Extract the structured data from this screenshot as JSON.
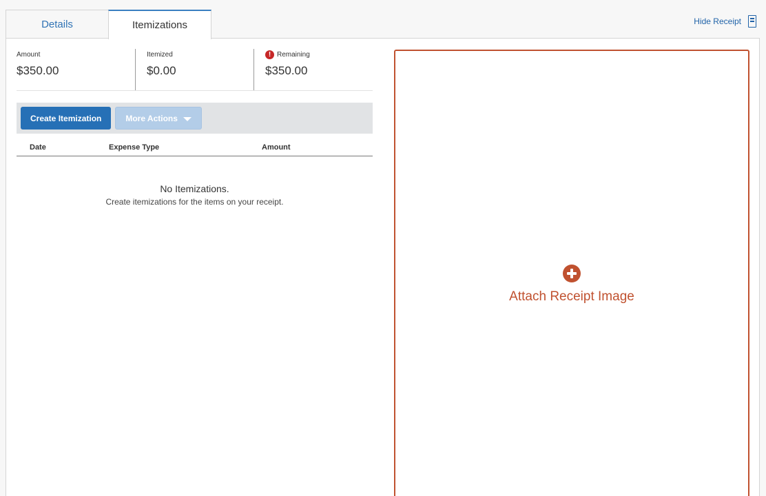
{
  "tabs": [
    {
      "label": "Details",
      "active": false
    },
    {
      "label": "Itemizations",
      "active": true
    }
  ],
  "header": {
    "hide_receipt_label": "Hide Receipt",
    "hide_receipt_icon": "receipt-icon"
  },
  "summary": {
    "amount": {
      "label": "Amount",
      "value": "$350.00"
    },
    "itemized": {
      "label": "Itemized",
      "value": "$0.00"
    },
    "remaining": {
      "label": "Remaining",
      "value": "$350.00",
      "icon": "warning-icon",
      "icon_color": "#c62727"
    }
  },
  "toolbar": {
    "create_label": "Create Itemization",
    "more_actions_label": "More Actions"
  },
  "table": {
    "columns": [
      "Date",
      "Expense Type",
      "Amount"
    ],
    "rows": []
  },
  "empty_state": {
    "title": "No Itemizations.",
    "subtitle": "Create itemizations for the items on your receipt."
  },
  "receipt": {
    "attach_label": "Attach Receipt Image",
    "icon": "plus-circle-icon",
    "accent_color": "#c0512f"
  },
  "colors": {
    "primary": "#2670b6",
    "link": "#1f62a8",
    "warning": "#c62727"
  }
}
